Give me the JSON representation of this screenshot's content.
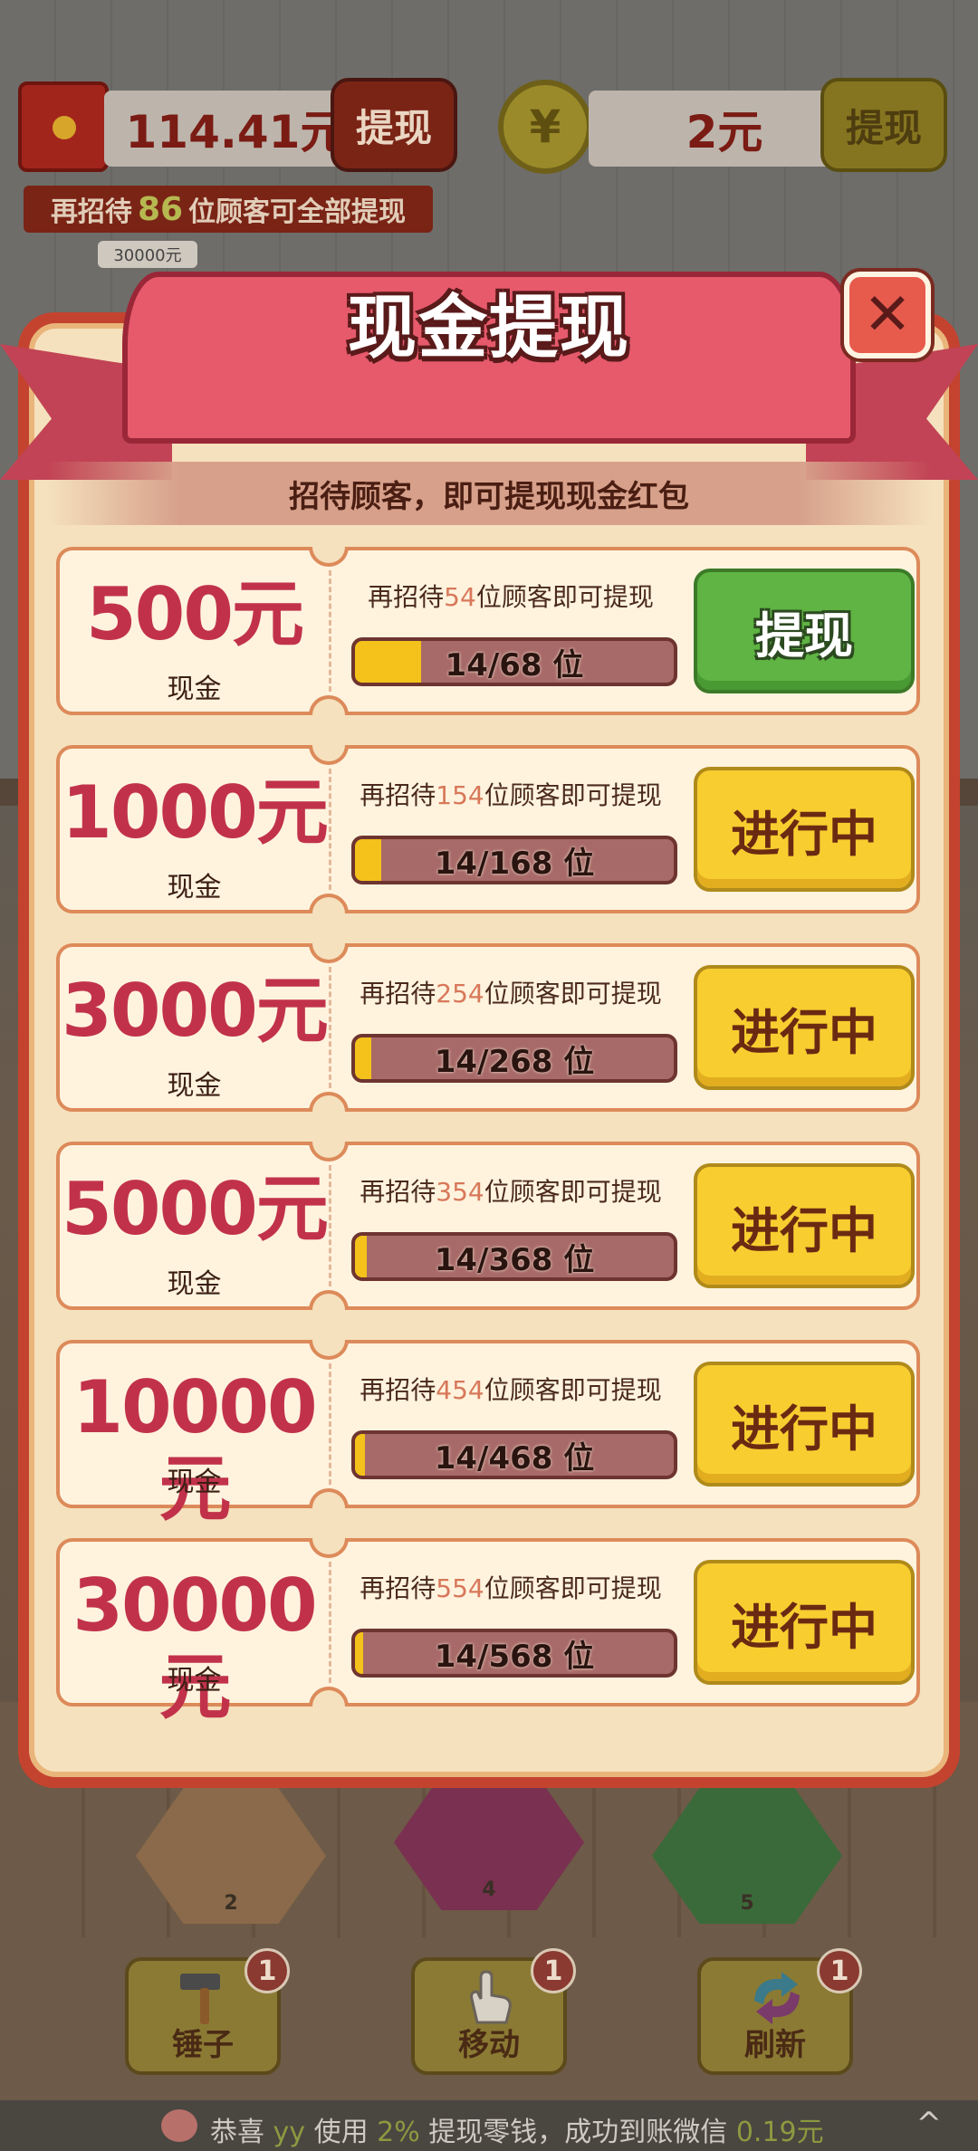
{
  "top": {
    "balance": "114.41元",
    "withdraw_label": "提现",
    "coin_symbol": "¥",
    "coin_balance": "2元",
    "coin_withdraw_label": "提现",
    "invite_prefix": "再招待",
    "invite_count": "86",
    "invite_suffix": "位顾客可全部提现",
    "chip_label": "30000元"
  },
  "background_tiles": [
    "2",
    "4",
    "5"
  ],
  "modal": {
    "title": "现金提现",
    "close_icon": "✕",
    "subtitle": "招待顾客，即可提现现金红包",
    "cards": [
      {
        "amount": "500元",
        "label": "现金",
        "req_prefix": "再招待",
        "req_count": "54",
        "req_suffix": "位顾客即可提现",
        "progress_text": "14/68 位",
        "progress": 0.206,
        "button": "提现",
        "button_style": "green"
      },
      {
        "amount": "1000元",
        "label": "现金",
        "req_prefix": "再招待",
        "req_count": "154",
        "req_suffix": "位顾客即可提现",
        "progress_text": "14/168 位",
        "progress": 0.083,
        "button": "进行中",
        "button_style": "yellow"
      },
      {
        "amount": "3000元",
        "label": "现金",
        "req_prefix": "再招待",
        "req_count": "254",
        "req_suffix": "位顾客即可提现",
        "progress_text": "14/268 位",
        "progress": 0.052,
        "button": "进行中",
        "button_style": "yellow"
      },
      {
        "amount": "5000元",
        "label": "现金",
        "req_prefix": "再招待",
        "req_count": "354",
        "req_suffix": "位顾客即可提现",
        "progress_text": "14/368 位",
        "progress": 0.038,
        "button": "进行中",
        "button_style": "yellow"
      },
      {
        "amount": "10000元",
        "label": "现金",
        "req_prefix": "再招待",
        "req_count": "454",
        "req_suffix": "位顾客即可提现",
        "progress_text": "14/468 位",
        "progress": 0.03,
        "button": "进行中",
        "button_style": "yellow"
      },
      {
        "amount": "30000元",
        "label": "现金",
        "req_prefix": "再招待",
        "req_count": "554",
        "req_suffix": "位顾客即可提现",
        "progress_text": "14/568 位",
        "progress": 0.025,
        "button": "进行中",
        "button_style": "yellow"
      }
    ]
  },
  "toolbar": {
    "items": [
      {
        "label": "锤子",
        "badge": "1",
        "icon": "hammer-icon"
      },
      {
        "label": "移动",
        "badge": "1",
        "icon": "hand-icon"
      },
      {
        "label": "刷新",
        "badge": "1",
        "icon": "refresh-icon"
      }
    ]
  },
  "ticker": {
    "prefix": "恭喜",
    "user": "yy",
    "mid": "使用",
    "percent": "2%",
    "text": "提现零钱，成功到账微信",
    "amount": "0.19元",
    "chevron": "^"
  },
  "colors": {
    "accent_red": "#c1324a",
    "button_green": "#5fb443",
    "button_yellow": "#f8cd30",
    "progress_fill": "#f4c21a"
  }
}
